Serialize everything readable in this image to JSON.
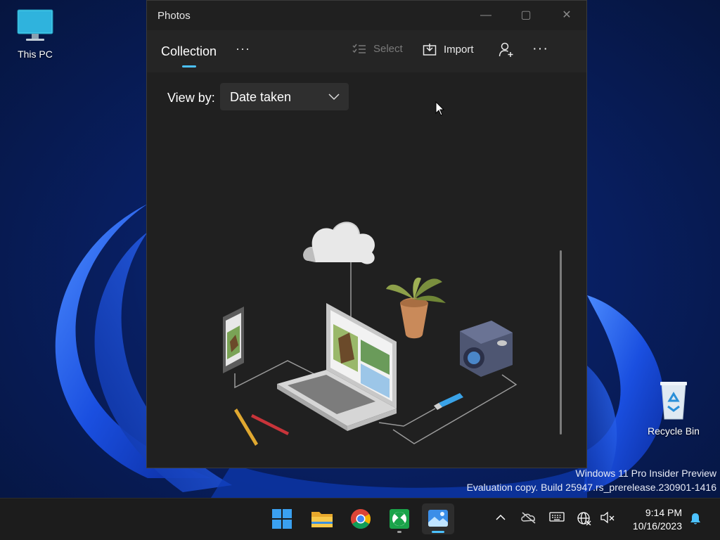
{
  "desktop": {
    "icons": [
      {
        "label": "This PC"
      },
      {
        "label": "Recycle Bin"
      }
    ],
    "watermark_line1": "Windows 11 Pro Insider Preview",
    "watermark_line2": "Evaluation copy. Build 25947.rs_prerelease.230901-1416"
  },
  "window": {
    "title": "Photos",
    "controls": {
      "minimize": "—",
      "maximize": "▢",
      "close": "✕"
    },
    "toolbar": {
      "tab_label": "Collection",
      "tab_more": "···",
      "select_label": "Select",
      "import_label": "Import",
      "overflow": "···"
    },
    "view_by": {
      "label": "View by:",
      "selected": "Date taken"
    }
  },
  "taskbar": {
    "apps": [
      "start",
      "file-explorer",
      "chrome",
      "xbox",
      "photos"
    ],
    "active_app": "photos",
    "clock_time": "9:14 PM",
    "clock_date": "10/16/2023"
  },
  "colors": {
    "accent": "#4cc2ff",
    "window_bg": "#202020",
    "taskbar_bg": "#1c1c1c"
  }
}
